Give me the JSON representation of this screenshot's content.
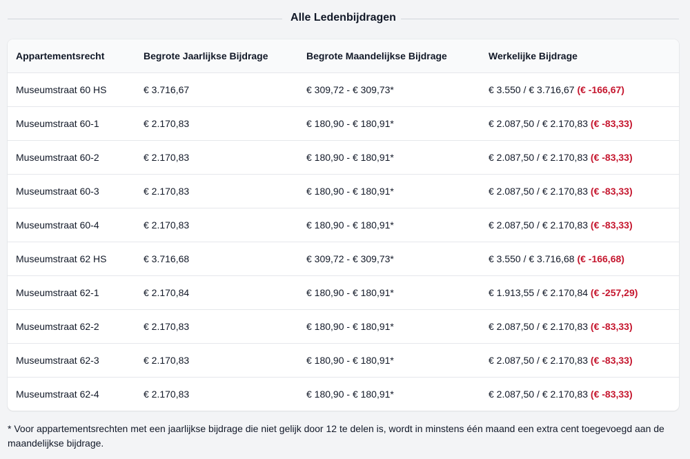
{
  "section_title": "Alle Ledenbijdragen",
  "table": {
    "headers": [
      "Appartementsrecht",
      "Begrote Jaarlijkse Bijdrage",
      "Begrote Maandelijkse Bijdrage",
      "Werkelijke Bijdrage"
    ],
    "rows": [
      {
        "apartment": "Museumstraat 60 HS",
        "annual": "€ 3.716,67",
        "monthly": "€ 309,72 - € 309,73*",
        "actual": "€ 3.550 / € 3.716,67",
        "difference": "(€ -166,67)"
      },
      {
        "apartment": "Museumstraat 60-1",
        "annual": "€ 2.170,83",
        "monthly": "€ 180,90 - € 180,91*",
        "actual": "€ 2.087,50 / € 2.170,83",
        "difference": "(€ -83,33)"
      },
      {
        "apartment": "Museumstraat 60-2",
        "annual": "€ 2.170,83",
        "monthly": "€ 180,90 - € 180,91*",
        "actual": "€ 2.087,50 / € 2.170,83",
        "difference": "(€ -83,33)"
      },
      {
        "apartment": "Museumstraat 60-3",
        "annual": "€ 2.170,83",
        "monthly": "€ 180,90 - € 180,91*",
        "actual": "€ 2.087,50 / € 2.170,83",
        "difference": "(€ -83,33)"
      },
      {
        "apartment": "Museumstraat 60-4",
        "annual": "€ 2.170,83",
        "monthly": "€ 180,90 - € 180,91*",
        "actual": "€ 2.087,50 / € 2.170,83",
        "difference": "(€ -83,33)"
      },
      {
        "apartment": "Museumstraat 62 HS",
        "annual": "€ 3.716,68",
        "monthly": "€ 309,72 - € 309,73*",
        "actual": "€ 3.550 / € 3.716,68",
        "difference": "(€ -166,68)"
      },
      {
        "apartment": "Museumstraat 62-1",
        "annual": "€ 2.170,84",
        "monthly": "€ 180,90 - € 180,91*",
        "actual": "€ 1.913,55 / € 2.170,84",
        "difference": "(€ -257,29)"
      },
      {
        "apartment": "Museumstraat 62-2",
        "annual": "€ 2.170,83",
        "monthly": "€ 180,90 - € 180,91*",
        "actual": "€ 2.087,50 / € 2.170,83",
        "difference": "(€ -83,33)"
      },
      {
        "apartment": "Museumstraat 62-3",
        "annual": "€ 2.170,83",
        "monthly": "€ 180,90 - € 180,91*",
        "actual": "€ 2.087,50 / € 2.170,83",
        "difference": "(€ -83,33)"
      },
      {
        "apartment": "Museumstraat 62-4",
        "annual": "€ 2.170,83",
        "monthly": "€ 180,90 - € 180,91*",
        "actual": "€ 2.087,50 / € 2.170,83",
        "difference": "(€ -83,33)"
      }
    ]
  },
  "footnote": "* Voor appartementsrechten met een jaarlijkse bijdrage die niet gelijk door 12 te delen is, wordt in minstens één maand een extra cent toegevoegd aan de maandelijkse bijdrage.",
  "colors": {
    "difference_negative": "#c5162e",
    "background": "#f3f4f6",
    "card": "#ffffff",
    "border": "#e5e7eb"
  }
}
